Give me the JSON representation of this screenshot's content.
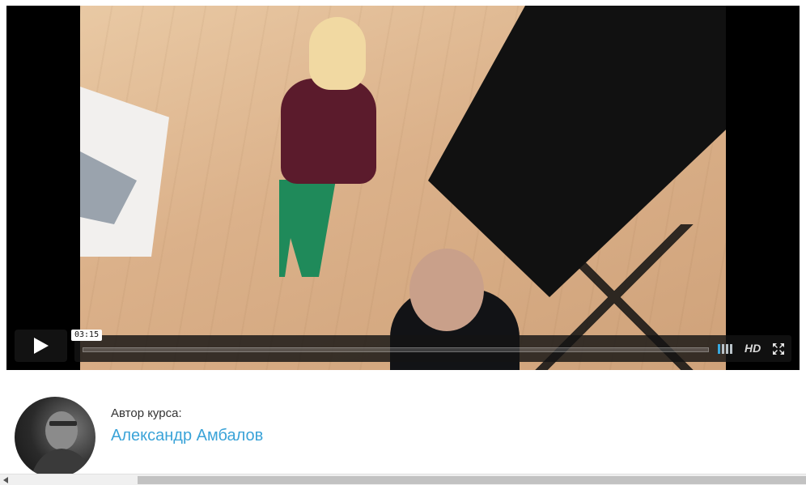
{
  "player": {
    "current_time": "03:15",
    "hd_label": "HD",
    "progress": 0,
    "volume_level": 0.25,
    "accent_color": "#37a9e0",
    "icons": {
      "play": "play-icon",
      "volume": "volume-icon",
      "fullscreen": "fullscreen-icon"
    }
  },
  "author": {
    "label": "Автор курса:",
    "name": "Александр Амбалов",
    "name_color": "#3aa3d8"
  }
}
